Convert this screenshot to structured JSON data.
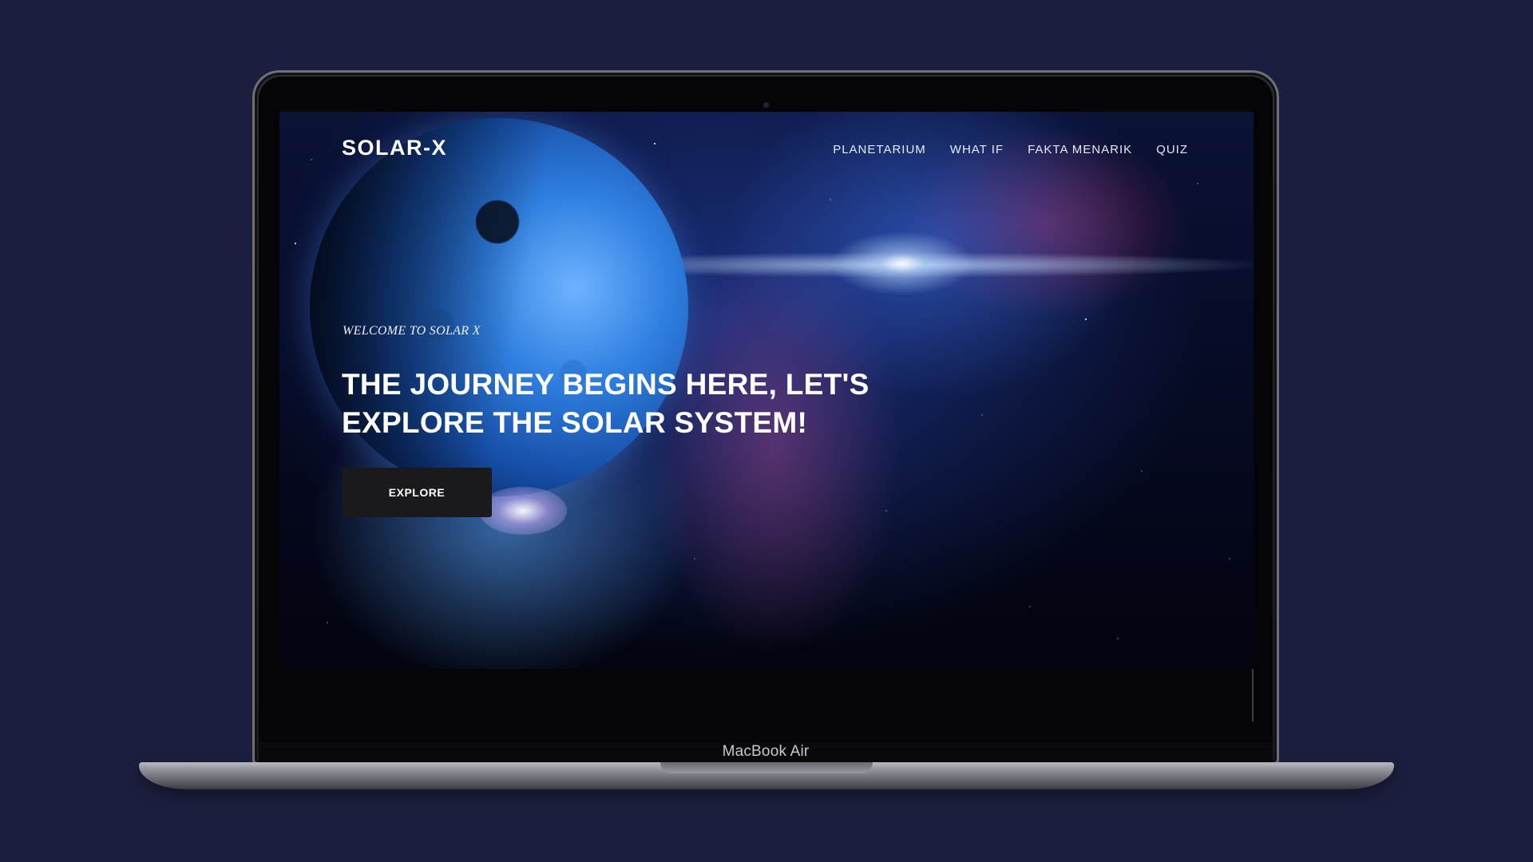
{
  "device": {
    "model_label": "MacBook Air"
  },
  "site": {
    "brand": "SOLAR-X",
    "nav": {
      "items": [
        {
          "label": "PLANETARIUM"
        },
        {
          "label": "WHAT IF"
        },
        {
          "label": "FAKTA MENARIK"
        },
        {
          "label": "QUIZ"
        }
      ]
    },
    "hero": {
      "welcome": "WELCOME TO SOLAR X",
      "headline": "THE JOURNEY BEGINS HERE, LET'S EXPLORE THE SOLAR SYSTEM!",
      "cta_label": "EXPLORE"
    }
  },
  "colors": {
    "page_background": "#1b1f3d",
    "button_background": "#1a1a1c",
    "text": "#ffffff"
  },
  "icons": [
    "camera-icon"
  ]
}
